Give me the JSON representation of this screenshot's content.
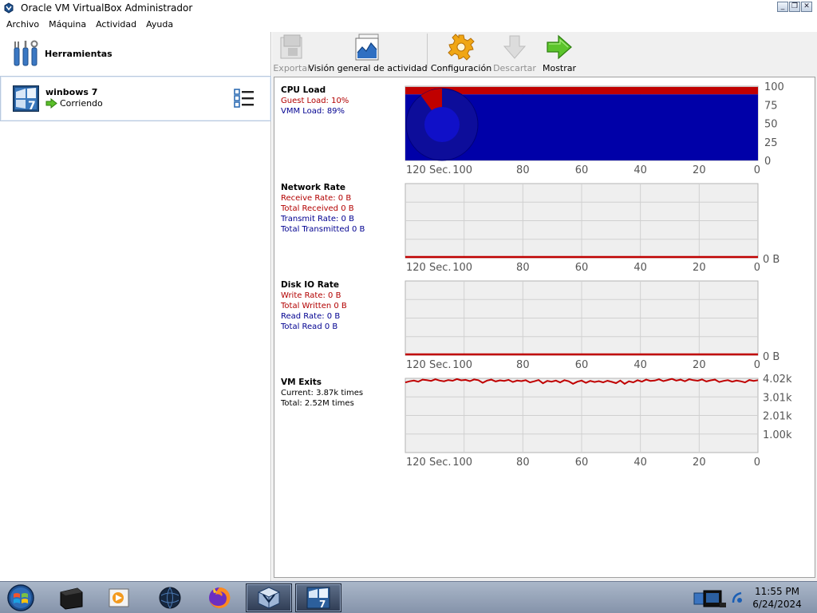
{
  "window": {
    "title": "Oracle VM VirtualBox Administrador"
  },
  "menu": [
    "Archivo",
    "Máquina",
    "Actividad",
    "Ayuda"
  ],
  "tools": {
    "label": "Herramientas"
  },
  "vm": {
    "name": "winbows 7",
    "state": "Corriendo"
  },
  "toolbar": {
    "export_label": "Exportar",
    "activity_label": "Visión general de actividad",
    "settings_label": "Configuración",
    "discard_label": "Descartar",
    "show_label": "Mostrar"
  },
  "metrics": {
    "cpu": {
      "title": "CPU Load",
      "guest": "Guest Load: 10%",
      "vmm": "VMM Load: 89%"
    },
    "network": {
      "title": "Network Rate",
      "receive": "Receive Rate: 0 B",
      "total_received": "Total Received 0 B",
      "transmit": "Transmit Rate: 0 B",
      "total_transmitted": "Total Transmitted 0 B"
    },
    "disk": {
      "title": "Disk IO Rate",
      "write": "Write Rate: 0 B",
      "total_written": "Total Written 0 B",
      "read": "Read Rate: 0 B",
      "total_read": "Total Read 0 B"
    },
    "exits": {
      "title": "VM Exits",
      "current": "Current: 3.87k times",
      "total": "Total: 2.52M times"
    }
  },
  "chart_data": [
    {
      "type": "area",
      "title": "CPU Load",
      "x_tick_labels": [
        "120 Sec.",
        "100",
        "80",
        "60",
        "40",
        "20",
        "0"
      ],
      "y_tick_labels": [
        "100",
        "75",
        "50",
        "25",
        "0"
      ],
      "ylim": [
        0,
        100
      ],
      "series": [
        {
          "name": "Guest Load",
          "values": [
            10
          ],
          "color": "#c00000"
        },
        {
          "name": "VMM Load",
          "values": [
            89
          ],
          "color": "#0000a8"
        }
      ],
      "pie": {
        "guest_pct": 10,
        "vmm_pct": 89
      }
    },
    {
      "type": "line",
      "title": "Network Rate",
      "x_tick_labels": [
        "120 Sec.",
        "100",
        "80",
        "60",
        "40",
        "20",
        "0"
      ],
      "y_tick_labels": [
        "0 B"
      ],
      "series": [
        {
          "values": [
            0,
            0
          ],
          "color": "#c00000"
        }
      ]
    },
    {
      "type": "line",
      "title": "Disk IO Rate",
      "x_tick_labels": [
        "120 Sec.",
        "100",
        "80",
        "60",
        "40",
        "20",
        "0"
      ],
      "y_tick_labels": [
        "0 B"
      ],
      "series": [
        {
          "values": [
            0,
            0
          ],
          "color": "#c00000"
        }
      ]
    },
    {
      "type": "line",
      "title": "VM Exits",
      "x_tick_labels": [
        "120 Sec.",
        "100",
        "80",
        "60",
        "40",
        "20",
        "0"
      ],
      "y_tick_labels": [
        "4.02k",
        "3.01k",
        "2.01k",
        "1.00k"
      ],
      "ylim": [
        0,
        4.02
      ],
      "series": [
        {
          "color": "#c00000",
          "values": [
            3.8,
            3.86,
            3.9,
            3.84,
            3.95,
            3.92,
            3.88,
            3.97,
            3.9,
            3.86,
            3.93,
            3.89,
            3.98,
            3.91,
            3.94,
            3.87,
            3.96,
            3.92,
            3.78,
            3.9,
            3.95,
            3.85,
            3.91,
            3.88,
            3.94,
            3.82,
            3.9,
            3.87,
            3.92,
            3.8,
            3.86,
            3.93,
            3.75,
            3.88,
            3.84,
            3.9,
            3.8,
            3.92,
            3.86,
            3.72,
            3.84,
            3.9,
            3.78,
            3.88,
            3.82,
            3.87,
            3.8,
            3.89,
            3.83,
            3.76,
            3.9,
            3.72,
            3.86,
            3.8,
            3.92,
            3.84,
            3.95,
            3.88,
            3.9,
            3.97,
            3.87,
            3.93,
            3.99,
            3.9,
            3.95,
            3.86,
            3.97,
            3.92,
            3.89,
            3.96,
            3.85,
            3.91,
            3.95,
            3.82,
            3.88,
            3.92,
            3.84,
            3.9,
            3.86,
            3.8,
            3.93,
            3.88,
            3.92
          ]
        }
      ]
    }
  ],
  "taskbar": {
    "time": "11:55 PM",
    "date": "6/24/2024"
  }
}
